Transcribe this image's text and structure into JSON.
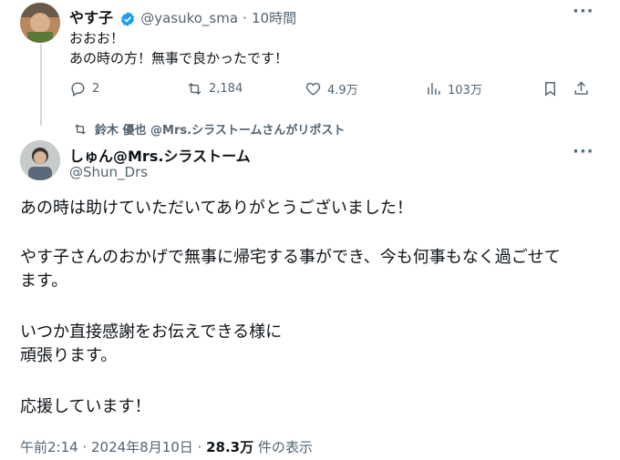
{
  "tweet1": {
    "name": "やす子",
    "handle": "@yasuko_sma",
    "dot": "·",
    "time": "10時間",
    "line1": "おおお！",
    "line2": "あの時の方！無事で良かったです！",
    "replies": "2",
    "retweets": "2,184",
    "likes": "4.9万",
    "views": "103万"
  },
  "repost": {
    "text": "鈴木 優也 @Mrs.シラストームさんがリポスト"
  },
  "tweet2": {
    "name": "しゅん@Mrs.シラストーム",
    "handle": "@Shun_Drs",
    "para1": "あの時は助けていただいてありがとうございました！",
    "para2a": "やす子さんのおかげで無事に帰宅する事ができ、今も何事もなく過ごせて",
    "para2b": "ます。",
    "para3a": "いつか直接感謝をお伝えできる様に",
    "para3b": "頑張ります。",
    "para4": "応援しています！",
    "timestamp": "午前2:14 · 2024年8月10日 · ",
    "view_count": "28.3万",
    "view_label": " 件の表示"
  },
  "icons": [
    "more-icon",
    "verified-icon",
    "reply-icon",
    "retweet-icon",
    "like-icon",
    "views-icon",
    "bookmark-icon",
    "share-icon",
    "repost-icon"
  ],
  "colors": {
    "text": "#0f1419",
    "muted": "#536471",
    "verified": "#1d9bf0",
    "line": "#cfd9de"
  }
}
